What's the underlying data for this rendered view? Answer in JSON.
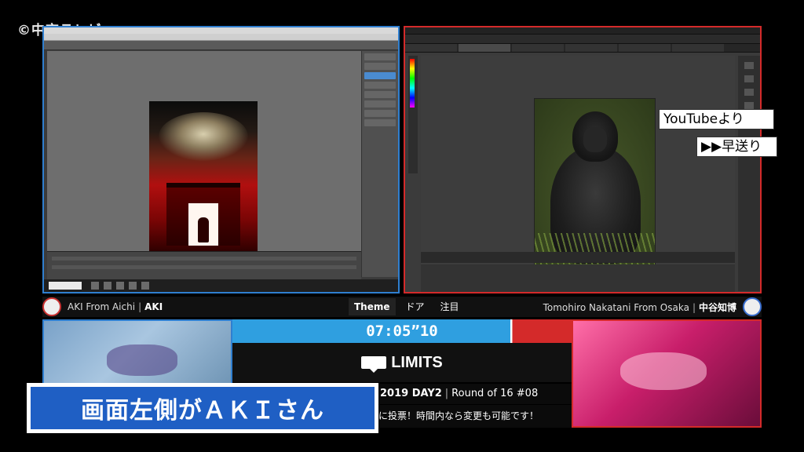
{
  "broadcast": {
    "watermark": "©中京テレビ",
    "caption_source": "YouTubeより",
    "caption_speed": "▶▶早送り",
    "subtitle": "画面左側がＡＫＩさん"
  },
  "players": {
    "left": {
      "from": "AKI From Aichi",
      "name": "AKI"
    },
    "right": {
      "from": "Tomohiro Nakatani From Osaka",
      "name": "中谷知博"
    }
  },
  "themes": [
    {
      "label": "Theme",
      "active": true
    },
    {
      "label": "ドア",
      "active": false
    },
    {
      "label": "注目",
      "active": false
    }
  ],
  "scoreboard": {
    "timer": "07:05”10",
    "theme_word": "LIMITS",
    "event": "2019 DAY2",
    "round": "Round of 16 #08",
    "vote_note": "に投票！時間内なら変更も可能です！"
  },
  "colors": {
    "left_accent": "#2f7fd0",
    "right_accent": "#d42a2a",
    "subtitle_bg": "#1f5fc4"
  }
}
